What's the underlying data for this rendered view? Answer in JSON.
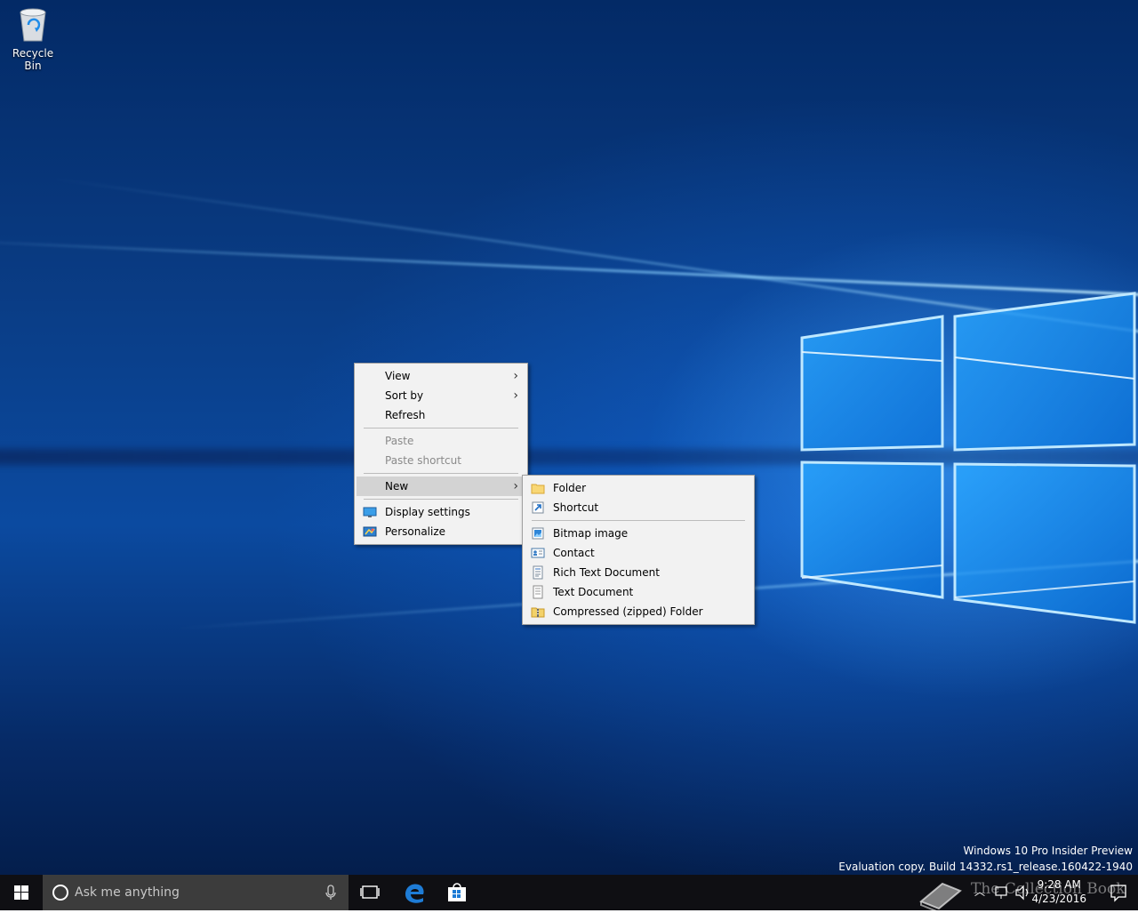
{
  "desktop": {
    "icons": [
      {
        "label": "Recycle Bin",
        "icon": "recycle-bin-icon"
      }
    ]
  },
  "context_menu": {
    "items": [
      {
        "label": "View",
        "submenu": true
      },
      {
        "label": "Sort by",
        "submenu": true
      },
      {
        "label": "Refresh"
      },
      {
        "label": "Paste",
        "disabled": true
      },
      {
        "label": "Paste shortcut",
        "disabled": true
      },
      {
        "label": "New",
        "submenu": true,
        "highlighted": true
      },
      {
        "label": "Display settings",
        "icon": "display-settings-icon"
      },
      {
        "label": "Personalize",
        "icon": "personalize-icon"
      }
    ]
  },
  "new_submenu": {
    "items": [
      {
        "label": "Folder",
        "icon": "folder-icon"
      },
      {
        "label": "Shortcut",
        "icon": "shortcut-icon"
      },
      {
        "label": "Bitmap image",
        "icon": "bitmap-image-icon"
      },
      {
        "label": "Contact",
        "icon": "contact-icon"
      },
      {
        "label": "Rich Text Document",
        "icon": "rich-text-document-icon"
      },
      {
        "label": "Text Document",
        "icon": "text-document-icon"
      },
      {
        "label": "Compressed (zipped) Folder",
        "icon": "zip-folder-icon"
      }
    ]
  },
  "watermark": {
    "line1": "Windows 10 Pro Insider Preview",
    "line2": "Evaluation copy. Build 14332.rs1_release.160422-1940"
  },
  "taskbar": {
    "search_placeholder": "Ask me anything",
    "clock_time": "9:28 AM",
    "clock_date": "4/23/2016",
    "overlay_text": "The Collection Book"
  },
  "colors": {
    "menu_bg": "#f2f2f2",
    "menu_highlight": "#d3d3d3",
    "taskbar_bg": "#0f0f13",
    "search_bg": "#3c3c3c",
    "edge_blue": "#1e7cd6"
  }
}
